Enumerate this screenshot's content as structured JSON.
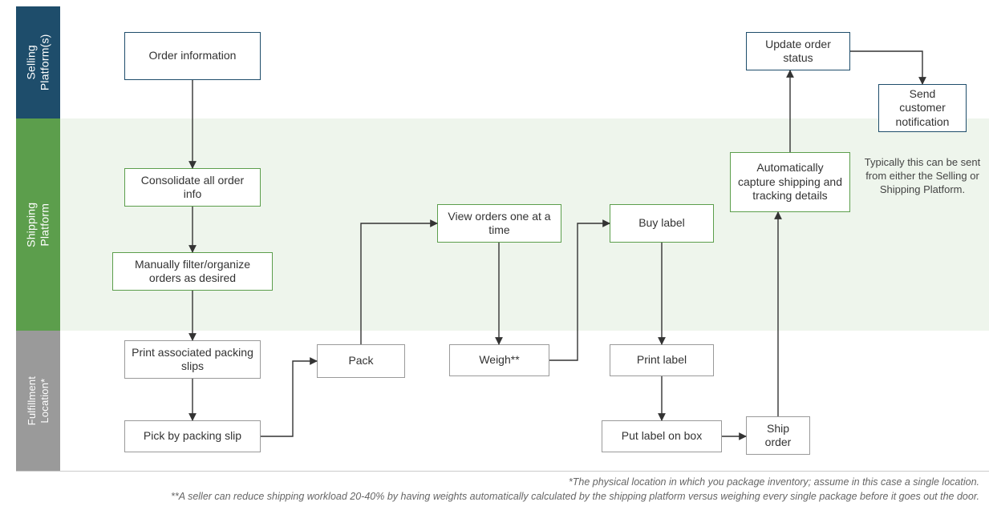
{
  "lanes": {
    "selling": "Selling\nPlatform(s)",
    "shipping": "Shipping\nPlatform",
    "fulfill": "Fulfillment\nLocation*"
  },
  "nodes": {
    "order_info": "Order information",
    "consolidate": "Consolidate all order info",
    "filter": "Manually filter/organize orders as desired",
    "print_slips": "Print associated packing slips",
    "pick": "Pick by packing slip",
    "pack": "Pack",
    "view_orders": "View orders one at a time",
    "weigh": "Weigh**",
    "buy_label": "Buy label",
    "print_label": "Print label",
    "put_label": "Put label on box",
    "ship_order": "Ship order",
    "capture_details": "Automatically capture shipping and tracking details",
    "update_status": "Update order status",
    "send_notif": "Send customer notification"
  },
  "sidenote": "Typically this can be sent from either the Selling or Shipping Platform.",
  "footnotes": {
    "f1": "*The physical location in which you package inventory; assume in this case a single location.",
    "f2": "**A seller can reduce shipping workload 20-40% by having weights automatically calculated by the shipping platform versus weighing every single package before it goes out the door."
  }
}
